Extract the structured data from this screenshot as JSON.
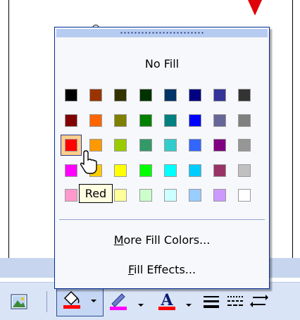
{
  "popup": {
    "no_fill_label": "No Fill",
    "more_fill_colors": {
      "accel": "M",
      "rest": "ore Fill Colors..."
    },
    "fill_effects": {
      "accel": "F",
      "rest": "ill Effects..."
    },
    "tooltip": "Red",
    "selected_color": "Red",
    "palette": [
      [
        "#000000",
        "#993300",
        "#333300",
        "#003300",
        "#003366",
        "#000080",
        "#333399",
        "#333333"
      ],
      [
        "#800000",
        "#ff6600",
        "#808000",
        "#008000",
        "#008080",
        "#0000ff",
        "#666699",
        "#808080"
      ],
      [
        "#ff0000",
        "#ff9900",
        "#99cc00",
        "#339966",
        "#33cccc",
        "#3366ff",
        "#800080",
        "#969696"
      ],
      [
        "#ff00ff",
        "#ffcc00",
        "#ffff00",
        "#00ff00",
        "#00ffff",
        "#00ccff",
        "#993366",
        "#c0c0c0"
      ],
      [
        "#ff99cc",
        "#ffcc99",
        "#ffff99",
        "#ccffcc",
        "#ccffff",
        "#99ccff",
        "#cc99ff",
        "#ffffff"
      ]
    ]
  },
  "toolbar": {
    "icons": [
      "insert-picture-icon",
      "fill-color-icon",
      "line-color-icon",
      "font-color-icon",
      "line-style-icon",
      "dash-style-icon",
      "arrow-style-icon"
    ],
    "fill_color": "#ff0000",
    "line_color": "#ff00ff",
    "font_color": "#ff0000"
  }
}
